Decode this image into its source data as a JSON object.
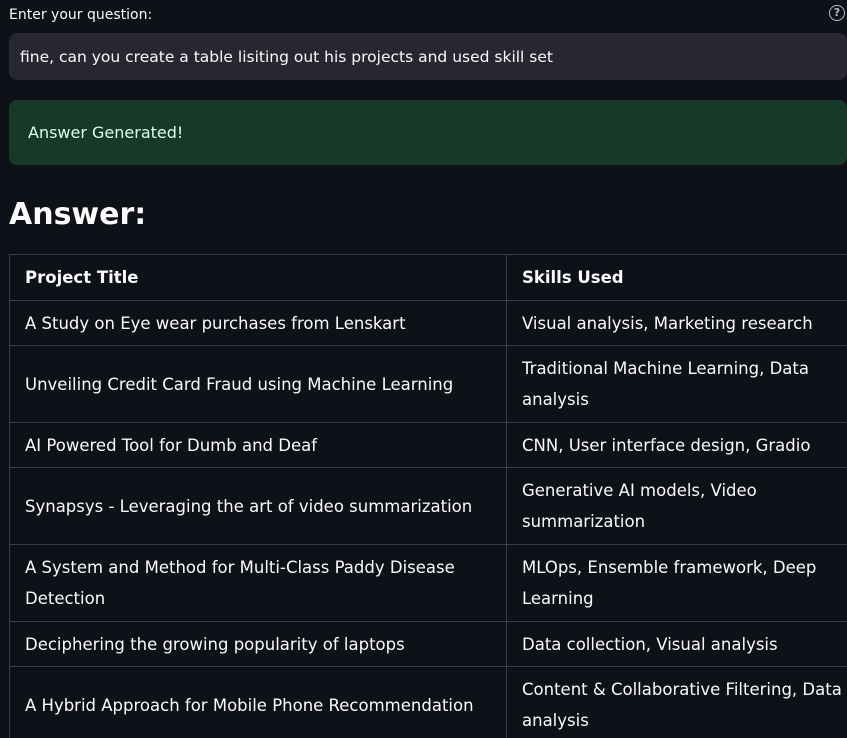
{
  "question": {
    "label": "Enter your question:",
    "value": "fine, can you create a table lisiting out his projects and used skill set",
    "help_icon": "question-circle-icon"
  },
  "alert": {
    "message": "Answer Generated!",
    "color": "#173928"
  },
  "answer": {
    "heading": "Answer:",
    "table": {
      "headers": [
        "Project Title",
        "Skills Used"
      ],
      "rows": [
        [
          "A Study on Eye wear purchases from Lenskart",
          "Visual analysis, Marketing research"
        ],
        [
          "Unveiling Credit Card Fraud using Machine Learning",
          "Traditional Machine Learning, Data analysis"
        ],
        [
          "AI Powered Tool for Dumb and Deaf",
          "CNN, User interface design, Gradio"
        ],
        [
          "Synapsys - Leveraging the art of video summarization",
          "Generative AI models, Video summarization"
        ],
        [
          "A System and Method for Multi-Class Paddy Disease Detection",
          "MLOps, Ensemble framework, Deep Learning"
        ],
        [
          "Deciphering the growing popularity of laptops",
          "Data collection, Visual analysis"
        ],
        [
          "A Hybrid Approach for Mobile Phone Recommendation",
          "Content & Collaborative Filtering, Data analysis"
        ]
      ]
    }
  }
}
